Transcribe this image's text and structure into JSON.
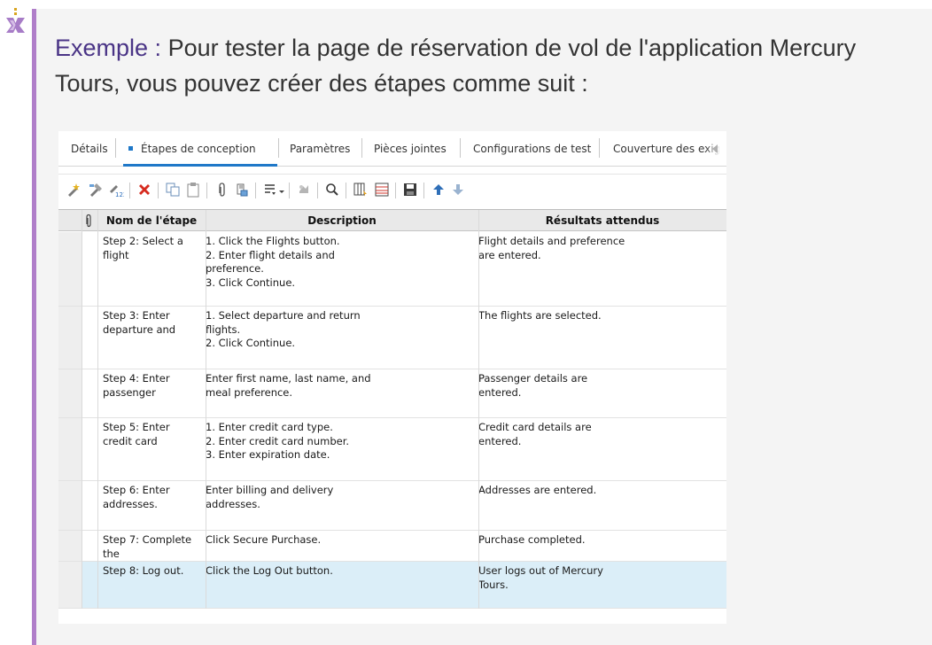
{
  "intro": {
    "lead": "Exemple :",
    "text": " Pour tester la page de réservation de vol de l'application Mercury Tours, vous pouvez créer des étapes comme suit :"
  },
  "tabs": [
    {
      "label": "Détails"
    },
    {
      "label": "Étapes de conception",
      "active": true
    },
    {
      "label": "Paramètres"
    },
    {
      "label": "Pièces jointes"
    },
    {
      "label": "Configurations de test"
    },
    {
      "label": "Couverture des exig"
    }
  ],
  "toolbar": {
    "icons": [
      "new-step-icon",
      "edit-step-icon",
      "renumber-steps-icon",
      "delete-icon",
      "copy-icon",
      "paste-icon",
      "attachment-icon",
      "call-to-test-icon",
      "insert-parameter-icon",
      "generate-script-icon",
      "find-icon",
      "select-columns-icon",
      "grid-filter-icon",
      "save-icon",
      "move-up-icon",
      "move-down-icon"
    ]
  },
  "grid": {
    "columns": {
      "name": "Nom de l'étape",
      "description": "Description",
      "expected": "Résultats attendus"
    },
    "rows": [
      {
        "name": "Step 2: Select a\nflight",
        "description": "1. Click the Flights button.\n2. Enter flight details and\npreference.\n3. Click Continue.",
        "expected": "Flight details and preference\nare entered."
      },
      {
        "name": "Step 3: Enter\ndeparture and",
        "description": "1. Select departure and return\nflights.\n2. Click Continue.",
        "expected": "The flights are selected."
      },
      {
        "name": "Step 4: Enter\npassenger",
        "description": "Enter first name, last name, and\nmeal preference.",
        "expected": "Passenger details are\nentered."
      },
      {
        "name": "Step 5: Enter\ncredit card",
        "description": "1. Enter credit card type.\n2. Enter credit card number.\n3. Enter expiration date.",
        "expected": "Credit card details are\nentered."
      },
      {
        "name": "Step 6: Enter\naddresses.",
        "description": "Enter billing and delivery\naddresses.",
        "expected": "Addresses are entered."
      },
      {
        "name": "Step 7: Complete\nthe",
        "description": "Click Secure Purchase.",
        "expected": "Purchase completed."
      },
      {
        "name": "Step 8: Log out.",
        "description": "Click the Log Out button.",
        "expected": "User logs out of Mercury\nTours.",
        "selected": true
      }
    ]
  },
  "colors": {
    "accent_bar": "#b07ec9",
    "lead_text": "#4a3486",
    "tab_active": "#1f78c8",
    "selected_row": "#dbeef8"
  }
}
